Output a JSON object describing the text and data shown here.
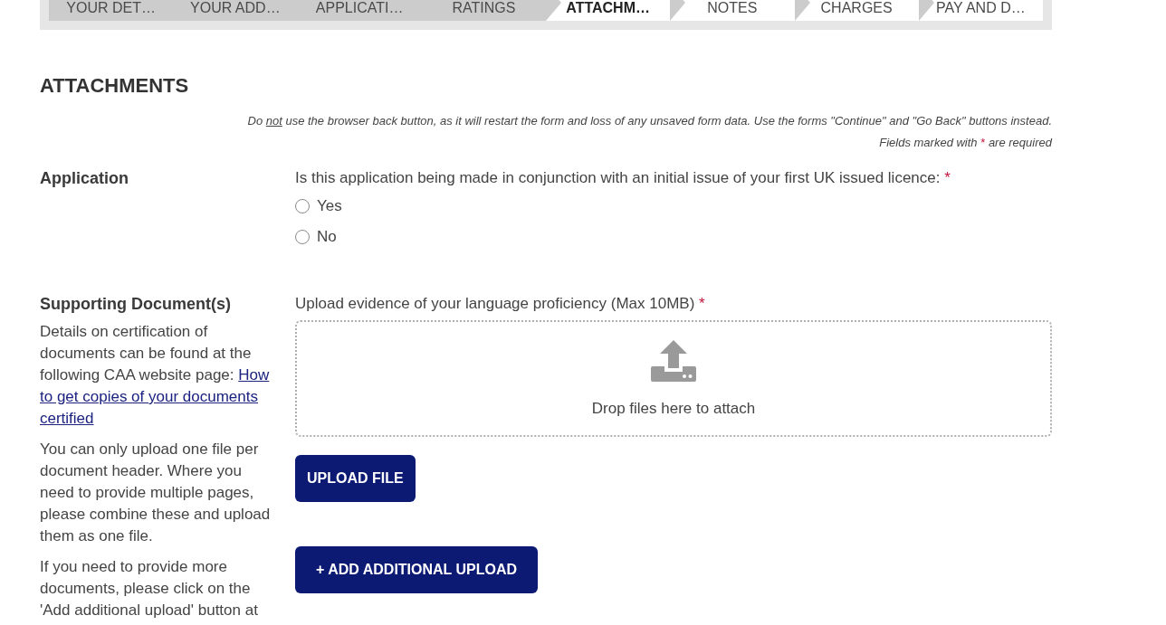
{
  "steps": [
    {
      "label": "YOUR DET…",
      "completed": true,
      "selected": false
    },
    {
      "label": "YOUR ADD…",
      "completed": true,
      "selected": false
    },
    {
      "label": "APPLICATI…",
      "completed": true,
      "selected": false
    },
    {
      "label": "RATINGS",
      "completed": true,
      "selected": false
    },
    {
      "label": "ATTACHM…",
      "completed": false,
      "selected": true
    },
    {
      "label": "NOTES",
      "completed": false,
      "selected": false
    },
    {
      "label": "CHARGES",
      "completed": false,
      "selected": false
    },
    {
      "label": "PAY AND D…",
      "completed": false,
      "selected": false
    }
  ],
  "page_title": "ATTACHMENTS",
  "notices": {
    "back_warning": {
      "before": "Do ",
      "underlined": "not",
      "after": " use the browser back button, as it will restart the form and loss of any unsaved form data. Use the forms \"Continue\" and \"Go Back\" buttons instead."
    },
    "required_hint": {
      "before": "Fields marked with ",
      "mark": "*",
      "after": " are required"
    }
  },
  "sections": [
    {
      "kind": "question",
      "heading": "Application",
      "question": {
        "text": "Is this application being made in conjunction with an initial issue of your first UK issued licence:",
        "required_mark": "*"
      },
      "options": [
        {
          "label": "Yes",
          "selected": false
        },
        {
          "label": "No",
          "selected": false
        }
      ]
    },
    {
      "kind": "upload",
      "heading": "Supporting Document(s)",
      "paragraphs": [
        {
          "text": "Details on certification of documents can be found at the following CAA website page:",
          "link_lines": [
            "How",
            "to get copies of your documents",
            "certified"
          ]
        },
        {
          "text": "You can only upload one file per document header. Where you need to provide multiple pages, please combine these and upload them as one file."
        },
        {
          "text": "If you need to provide more documents, please click on the 'Add additional upload' button at"
        }
      ],
      "upload": {
        "label": "Upload evidence of your language proficiency (Max 10MB)",
        "required_mark": "*",
        "drop_text": "Drop files here to attach",
        "button": "UPLOAD FILE"
      },
      "add_button": "+ ADD ADDITIONAL UPLOAD"
    }
  ]
}
